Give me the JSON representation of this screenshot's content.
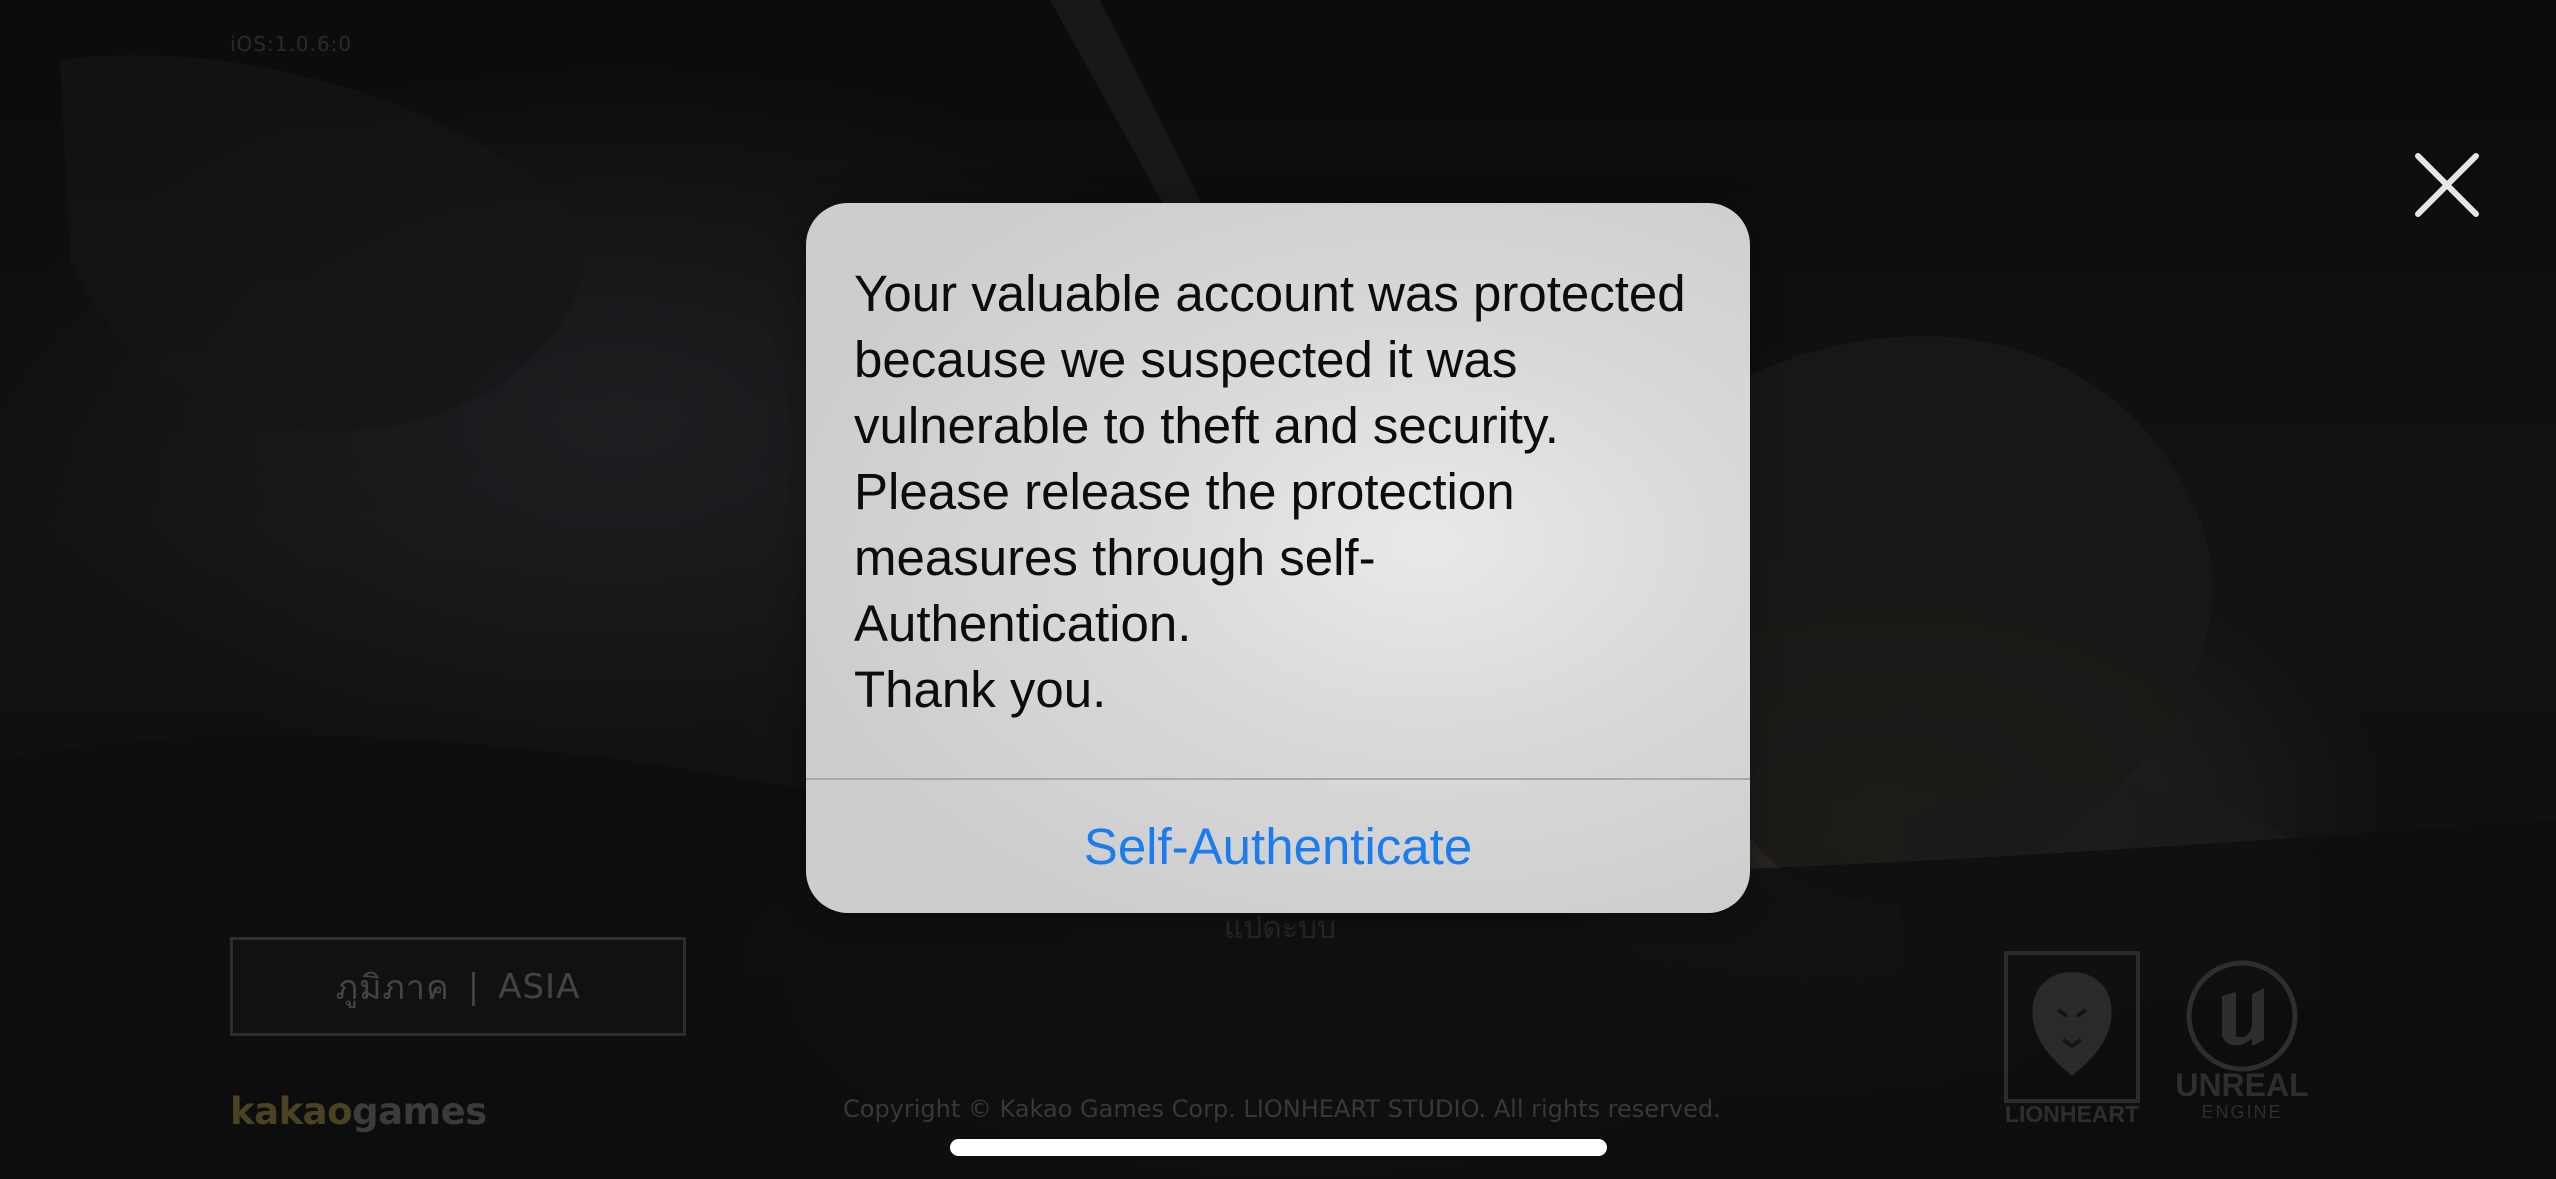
{
  "game": {
    "version_label": "iOS:1.0.6:0",
    "region_label": "ภูมิภาค",
    "region_separator": "|",
    "region_value": "ASIA",
    "obscured_text": "แปดะบบ",
    "copyright": "Copyright © Kakao Games Corp. LIONHEART STUDIO. All rights reserved.",
    "publisher_logo": {
      "part1": "kakao",
      "part2": "games"
    },
    "studio_logo": "LIONHEART",
    "engine_logo": {
      "line1": "UNREAL",
      "line2": "ENGINE"
    }
  },
  "alert": {
    "message": "Your valuable account was protected\nbecause we suspected it was\nvulnerable to theft and security.\nPlease release the protection\nmeasures through self-\nAuthentication.\nThank you.",
    "action_label": "Self-Authenticate"
  },
  "icons": {
    "close": "close-icon"
  },
  "colors": {
    "alert_background": "#dcdcdc",
    "action_blue": "#1b7cf0",
    "close_icon": "#e6e6e6",
    "kakao_yellow": "#4a4323"
  }
}
